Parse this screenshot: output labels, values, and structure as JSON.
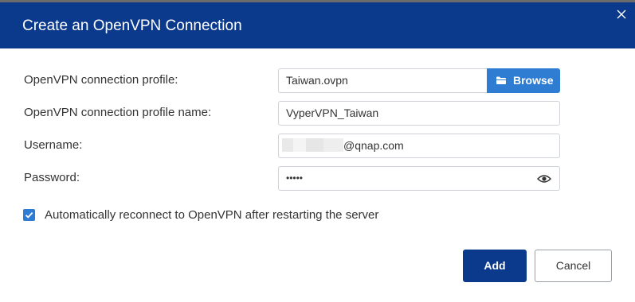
{
  "dialog": {
    "title": "Create an OpenVPN Connection"
  },
  "form": {
    "profile_label": "OpenVPN connection profile:",
    "profile_value": "Taiwan.ovpn",
    "browse_label": "Browse",
    "profile_name_label": "OpenVPN connection profile name:",
    "profile_name_value": "VyperVPN_Taiwan",
    "username_label": "Username:",
    "username_value_suffix": "@qnap.com",
    "password_label": "Password:",
    "password_value": "•••••",
    "auto_reconnect_label": "Automatically reconnect to OpenVPN after restarting the server",
    "auto_reconnect_checked": true
  },
  "footer": {
    "add_label": "Add",
    "cancel_label": "Cancel"
  },
  "colors": {
    "header": "#0b3a8c",
    "accent": "#2f7dd3",
    "primary_button": "#0b3a8c"
  },
  "icons": {
    "close": "close-icon",
    "browse": "folder-icon",
    "password_toggle": "eye-icon",
    "checkbox": "checkmark-icon"
  }
}
